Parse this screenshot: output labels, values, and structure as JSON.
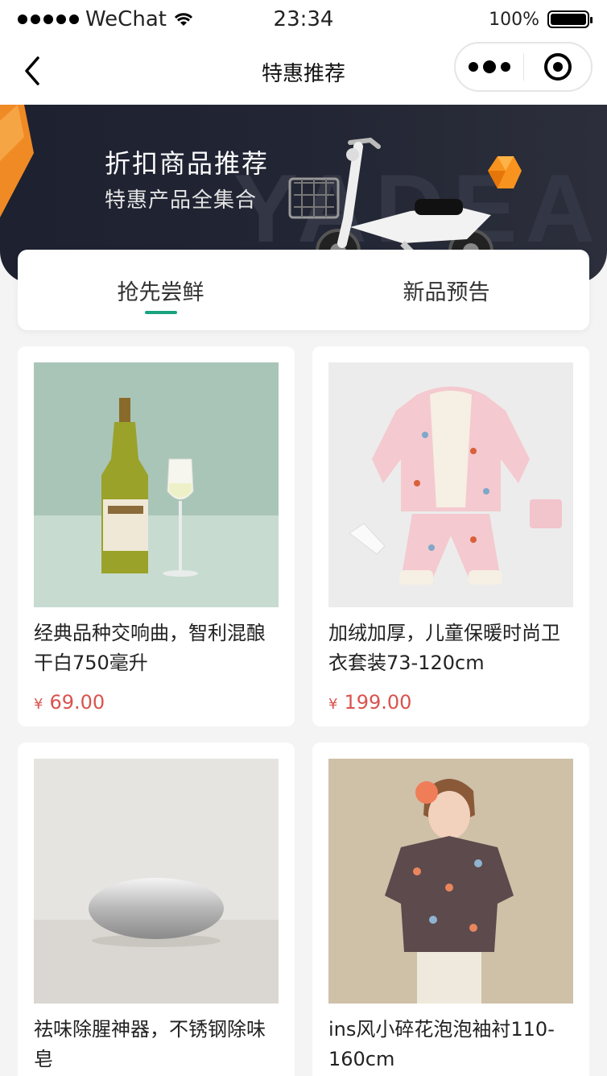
{
  "status_bar": {
    "carrier": "WeChat",
    "time": "23:34",
    "battery": "100%"
  },
  "nav": {
    "title": "特惠推荐"
  },
  "banner": {
    "title": "折扣商品推荐",
    "subtitle": "特惠产品全集合",
    "watermark": "YADEA"
  },
  "tabs": [
    {
      "label": "抢先尝鲜",
      "active": true
    },
    {
      "label": "新品预告",
      "active": false
    }
  ],
  "products": [
    {
      "name": "经典品种交响曲，智利混酿干白750毫升",
      "currency": "¥",
      "price": "69.00",
      "image": "wine-bottle-image"
    },
    {
      "name": "加绒加厚，儿童保暖时尚卫衣套装73-120cm",
      "currency": "¥",
      "price": "199.00",
      "image": "kids-hoodie-set-image"
    },
    {
      "name": "祛味除腥神器，不锈钢除味皂",
      "currency": "¥",
      "price": "",
      "image": "steel-soap-image"
    },
    {
      "name": "ins风小碎花泡泡袖衬110-160cm",
      "currency": "¥",
      "price": "",
      "image": "floral-blouse-image"
    }
  ],
  "colors": {
    "accent": "#1aa37f",
    "price": "#d9534f",
    "banner_bg": "#1d2130"
  }
}
